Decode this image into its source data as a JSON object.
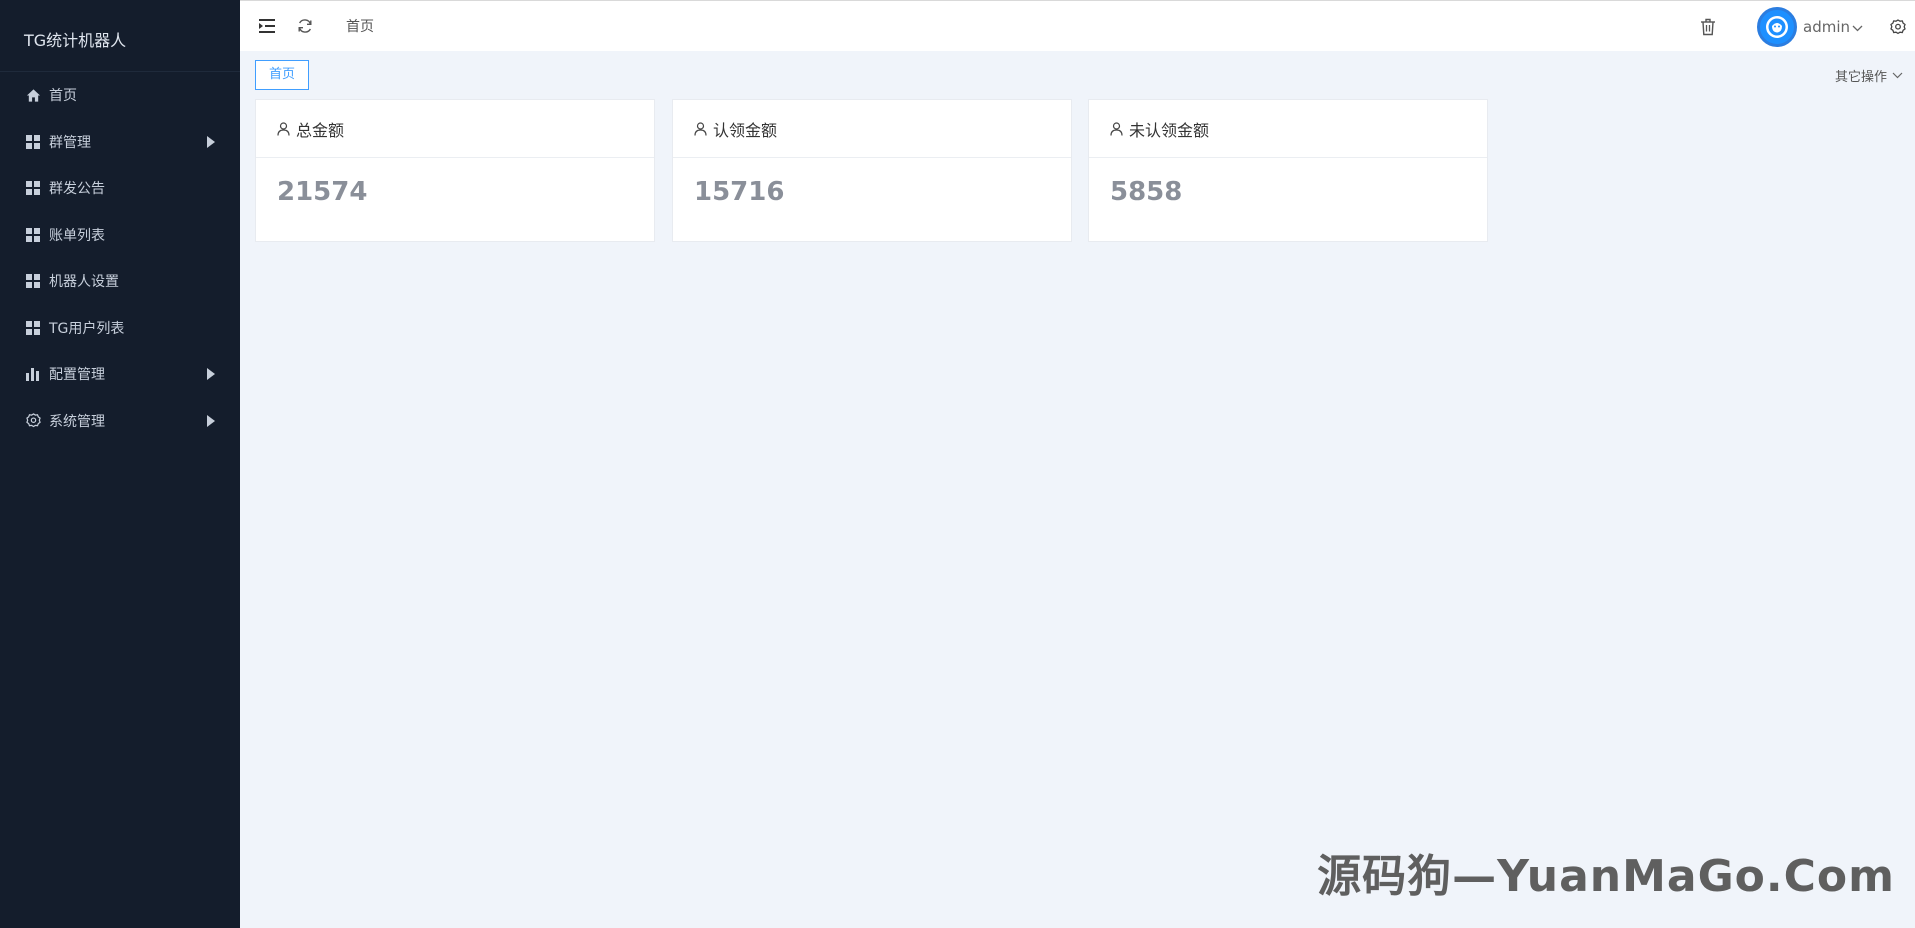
{
  "sidebar": {
    "title": "TG统计机器人",
    "items": [
      {
        "label": "首页",
        "icon": "home-icon"
      },
      {
        "label": "群管理",
        "icon": "grid-icon",
        "has_submenu": true
      },
      {
        "label": "群发公告",
        "icon": "grid-icon"
      },
      {
        "label": "账单列表",
        "icon": "grid-icon"
      },
      {
        "label": "机器人设置",
        "icon": "grid-icon"
      },
      {
        "label": "TG用户列表",
        "icon": "grid-icon"
      },
      {
        "label": "配置管理",
        "icon": "bar-chart-icon",
        "has_submenu": true
      },
      {
        "label": "系统管理",
        "icon": "gear-icon",
        "has_submenu": true
      }
    ]
  },
  "header": {
    "breadcrumb": "首页",
    "username": "admin"
  },
  "tabs": {
    "active": "首页",
    "other_ops": "其它操作"
  },
  "cards": [
    {
      "title": "总金额",
      "value": "21574"
    },
    {
      "title": "认领金额",
      "value": "15716"
    },
    {
      "title": "未认领金额",
      "value": "5858"
    }
  ],
  "watermark": "源码狗—YuanMaGo.Com",
  "colors": {
    "sidebar_bg": "#141d2c",
    "accent": "#409eff",
    "page_bg": "#f0f4fa"
  }
}
